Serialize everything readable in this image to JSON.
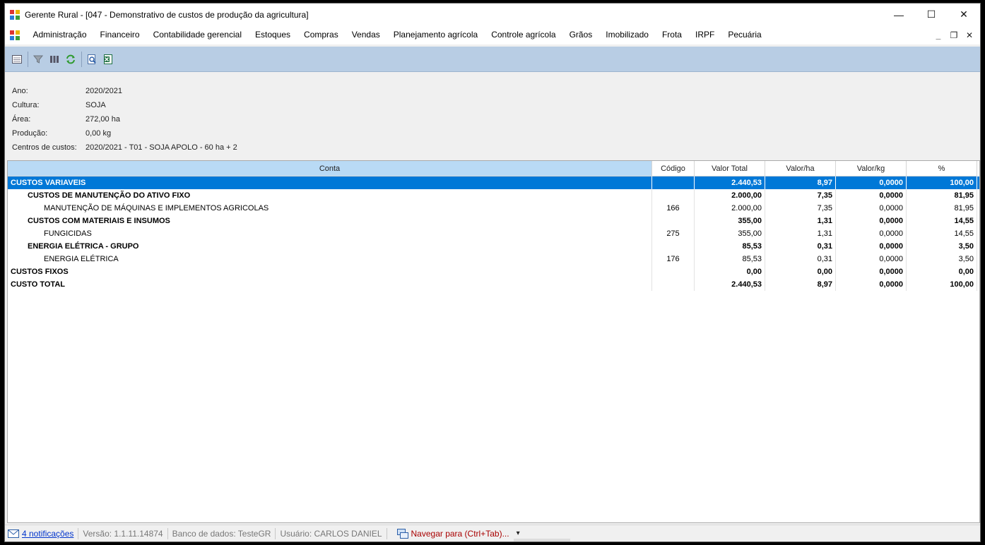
{
  "window": {
    "title": "Gerente Rural - [047 - Demonstrativo de custos de produção da agricultura]",
    "controls": {
      "minimize": "—",
      "maximize": "☐",
      "close": "✕"
    }
  },
  "menu": {
    "items": [
      "Administração",
      "Financeiro",
      "Contabilidade gerencial",
      "Estoques",
      "Compras",
      "Vendas",
      "Planejamento agrícola",
      "Controle agrícola",
      "Grãos",
      "Imobilizado",
      "Frota",
      "IRPF",
      "Pecuária"
    ],
    "mdi": {
      "minimize": "_",
      "restore": "❐",
      "close": "✕"
    }
  },
  "toolbar": {
    "icons": [
      "list-view-icon",
      "filter-icon",
      "columns-icon",
      "refresh-icon",
      "preview-icon",
      "excel-export-icon"
    ]
  },
  "info": {
    "ano_label": "Ano:",
    "ano_value": "2020/2021",
    "cultura_label": "Cultura:",
    "cultura_value": "SOJA",
    "area_label": "Área:",
    "area_value": "272,00 ha",
    "producao_label": "Produção:",
    "producao_value": "0,00 kg",
    "centros_label": "Centros de custos:",
    "centros_value": "2020/2021 - T01 - SOJA APOLO - 60 ha + 2"
  },
  "grid": {
    "columns": {
      "conta": "Conta",
      "codigo": "Código",
      "valor_total": "Valor Total",
      "valor_ha": "Valor/ha",
      "valor_kg": "Valor/kg",
      "pct": "%"
    },
    "rows": [
      {
        "conta": "CUSTOS VARIAVEIS",
        "indent": 0,
        "bold": true,
        "selected": true,
        "codigo": "",
        "valor_total": "2.440,53",
        "valor_ha": "8,97",
        "valor_kg": "0,0000",
        "pct": "100,00"
      },
      {
        "conta": "CUSTOS DE MANUTENÇÃO DO ATIVO FIXO",
        "indent": 1,
        "bold": true,
        "selected": false,
        "codigo": "",
        "valor_total": "2.000,00",
        "valor_ha": "7,35",
        "valor_kg": "0,0000",
        "pct": "81,95"
      },
      {
        "conta": "MANUTENÇÃO DE MÁQUINAS E IMPLEMENTOS AGRICOLAS",
        "indent": 2,
        "bold": false,
        "selected": false,
        "codigo": "166",
        "valor_total": "2.000,00",
        "valor_ha": "7,35",
        "valor_kg": "0,0000",
        "pct": "81,95"
      },
      {
        "conta": "CUSTOS COM MATERIAIS E INSUMOS",
        "indent": 1,
        "bold": true,
        "selected": false,
        "codigo": "",
        "valor_total": "355,00",
        "valor_ha": "1,31",
        "valor_kg": "0,0000",
        "pct": "14,55"
      },
      {
        "conta": "FUNGICIDAS",
        "indent": 2,
        "bold": false,
        "selected": false,
        "codigo": "275",
        "valor_total": "355,00",
        "valor_ha": "1,31",
        "valor_kg": "0,0000",
        "pct": "14,55"
      },
      {
        "conta": "ENERGIA ELÉTRICA - GRUPO",
        "indent": 1,
        "bold": true,
        "selected": false,
        "codigo": "",
        "valor_total": "85,53",
        "valor_ha": "0,31",
        "valor_kg": "0,0000",
        "pct": "3,50"
      },
      {
        "conta": "ENERGIA ELÉTRICA",
        "indent": 2,
        "bold": false,
        "selected": false,
        "codigo": "176",
        "valor_total": "85,53",
        "valor_ha": "0,31",
        "valor_kg": "0,0000",
        "pct": "3,50"
      },
      {
        "conta": "CUSTOS FIXOS",
        "indent": 0,
        "bold": true,
        "selected": false,
        "codigo": "",
        "valor_total": "0,00",
        "valor_ha": "0,00",
        "valor_kg": "0,0000",
        "pct": "0,00"
      },
      {
        "conta": "CUSTO TOTAL",
        "indent": 0,
        "bold": true,
        "selected": false,
        "codigo": "",
        "valor_total": "2.440,53",
        "valor_ha": "8,97",
        "valor_kg": "0,0000",
        "pct": "100,00"
      }
    ]
  },
  "status": {
    "notifications": "4 notificações",
    "version": "Versão: 1.1.11.14874",
    "database": "Banco de dados: TesteGR",
    "user": "Usuário: CARLOS DANIEL",
    "navigate": "Navegar para (Ctrl+Tab)...",
    "navigate_arrow": "▾"
  },
  "colors": {
    "selection": "#0078d7",
    "toolbar": "#b8cde4",
    "header_highlight": "#b9daf5",
    "link": "#0033cc",
    "navigate": "#a80000"
  }
}
